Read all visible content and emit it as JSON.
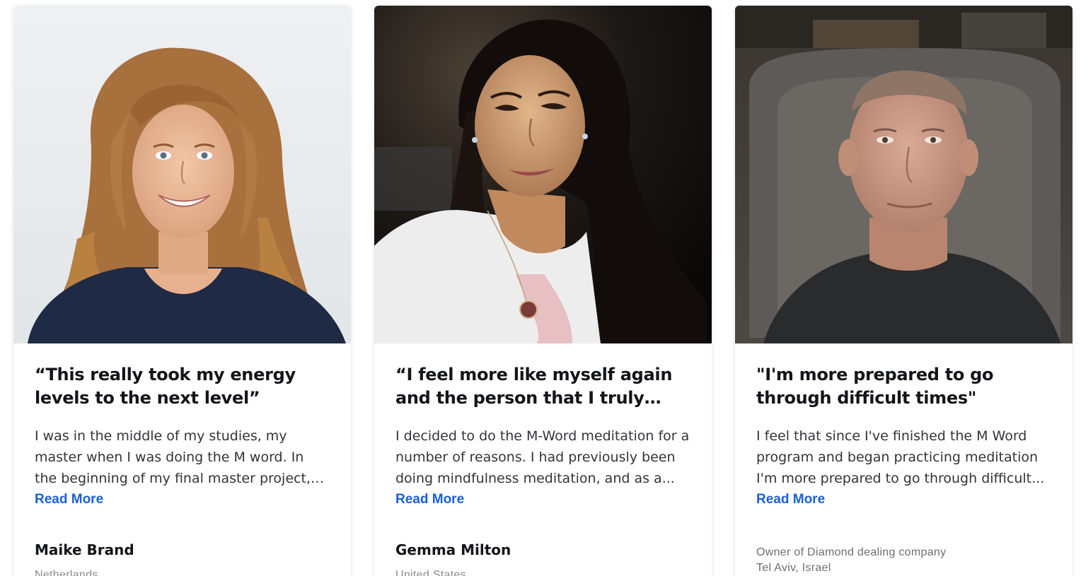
{
  "testimonials": [
    {
      "photo_alt": "portrait-woman-curly-hair",
      "quote": "“This really took my energy levels to the next level”",
      "excerpt": "I was in the middle of my studies, my master when I was doing the M word. In the beginning of my final master project, whic...",
      "read_more": "Read More",
      "name": "Maike Brand",
      "role": "",
      "location": "Netherlands"
    },
    {
      "photo_alt": "portrait-woman-dark-hair",
      "quote": "“I feel more like myself again and the person that I truly wa...",
      "excerpt": "I decided to do the M-Word meditation for a number of reasons. I had previously been doing mindfulness meditation, and as a...",
      "read_more": "Read More",
      "name": "Gemma Milton",
      "role": "",
      "location": "United States"
    },
    {
      "photo_alt": "portrait-man-armchair",
      "quote": "\"I'm more prepared to go through difficult times\"",
      "excerpt": "I feel that since I've finished the M Word program and began practicing meditation I'm more prepared to go through difficult...",
      "read_more": "Read More",
      "name": "",
      "role": "Owner of Diamond dealing company",
      "location": "Tel Aviv, Israel"
    }
  ],
  "colors": {
    "link": "#1a5fd6",
    "heading": "#14151a",
    "body_text": "#33343a",
    "muted": "#8a8b90"
  }
}
